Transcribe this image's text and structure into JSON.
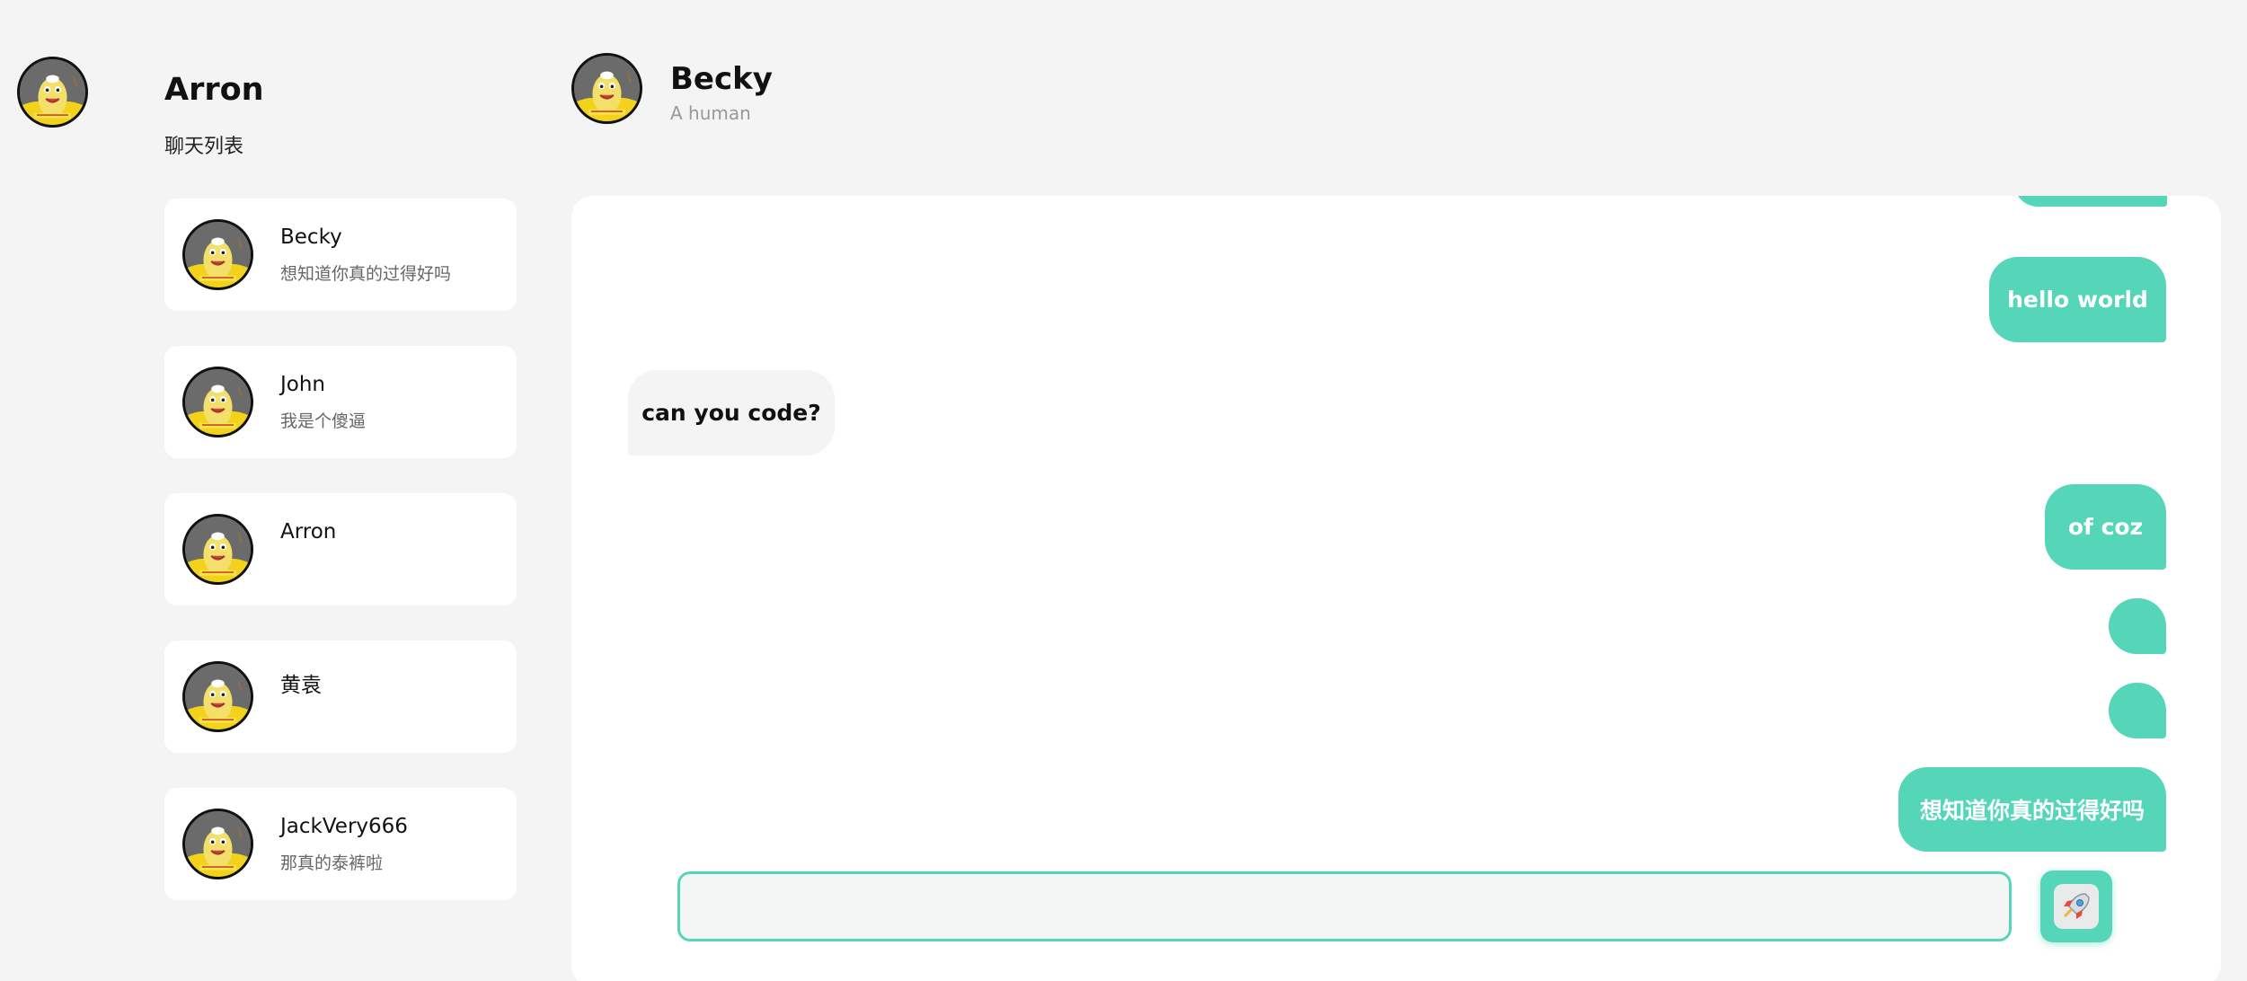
{
  "user": {
    "name": "Arron"
  },
  "sidebar": {
    "title": "聊天列表",
    "chats": [
      {
        "name": "Becky",
        "preview": "想知道你真的过得好吗"
      },
      {
        "name": "John",
        "preview": "我是个傻逼"
      },
      {
        "name": "Arron",
        "preview": ""
      },
      {
        "name": "黄袁",
        "preview": ""
      },
      {
        "name": "JackVery666",
        "preview": "那真的泰裤啦"
      }
    ]
  },
  "conversation": {
    "name": "Becky",
    "subtitle": "A human",
    "messages": [
      {
        "from": "me",
        "text": ""
      },
      {
        "from": "me",
        "text": "hello world"
      },
      {
        "from": "them",
        "text": "can you code?"
      },
      {
        "from": "me",
        "text": "of coz"
      },
      {
        "from": "me",
        "text": ""
      },
      {
        "from": "me",
        "text": ""
      },
      {
        "from": "me",
        "text": "想知道你真的过得好吗"
      }
    ]
  },
  "composer": {
    "value": "",
    "placeholder": ""
  },
  "send_button": {
    "icon": "rocket-icon"
  },
  "colors": {
    "accent": "#55d6b9",
    "background": "#f4f4f4",
    "panel": "#ffffff",
    "incoming_bubble": "#f4f4f4"
  }
}
